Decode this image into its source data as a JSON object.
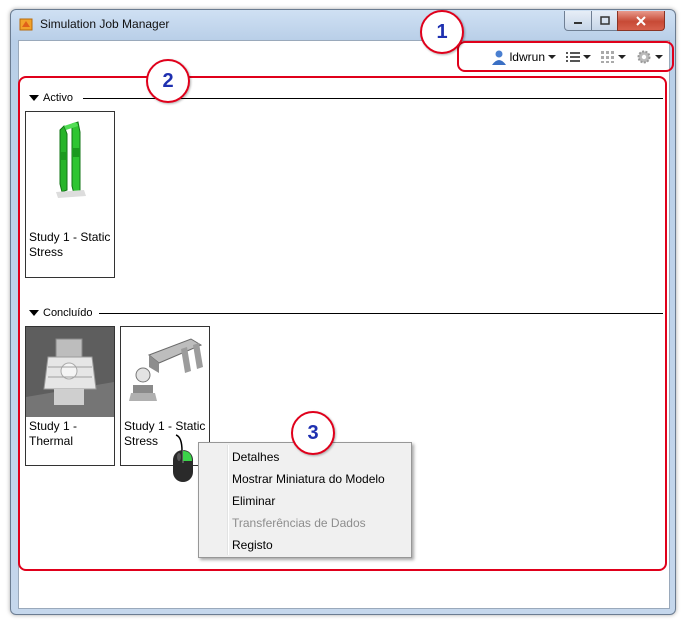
{
  "window": {
    "title": "Simulation Job Manager"
  },
  "toolbar": {
    "user": "ldwrun"
  },
  "sections": {
    "active": {
      "label": "Activo",
      "cards": [
        {
          "label": "Study 1 - Static Stress"
        }
      ]
    },
    "done": {
      "label": "Concluído",
      "cards": [
        {
          "label": "Study 1 - Thermal"
        },
        {
          "label": "Study 1 - Static Stress"
        }
      ]
    }
  },
  "context_menu": {
    "items": [
      {
        "label": "Detalhes",
        "enabled": true
      },
      {
        "label": "Mostrar Miniatura do Modelo",
        "enabled": true
      },
      {
        "label": "Eliminar",
        "enabled": true
      },
      {
        "label": "Transferências de Dados",
        "enabled": false
      },
      {
        "label": "Registo",
        "enabled": true
      }
    ]
  },
  "callouts": [
    "1",
    "2",
    "3"
  ],
  "colors": {
    "annotation_red": "#e0001b",
    "badge_number": "#1e30b0"
  }
}
